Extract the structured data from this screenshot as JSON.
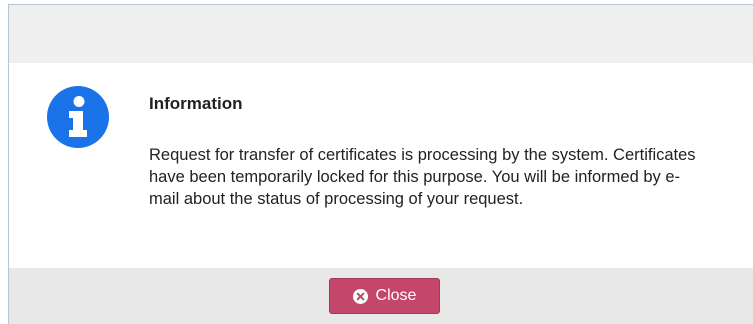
{
  "dialog": {
    "title": "Information",
    "message": "Request for transfer of certificates is processing by the system. Certificates have been temporarily locked for this purpose. You will be informed by e-mail about the status of processing of your request.",
    "icon": "info-circle-icon",
    "close_label": "Close",
    "close_icon": "times-circle-icon"
  },
  "colors": {
    "info_icon": "#1a73e8",
    "close_button": "#c4466a",
    "header_bg": "#efefef",
    "footer_bg": "#e8e8e8"
  }
}
